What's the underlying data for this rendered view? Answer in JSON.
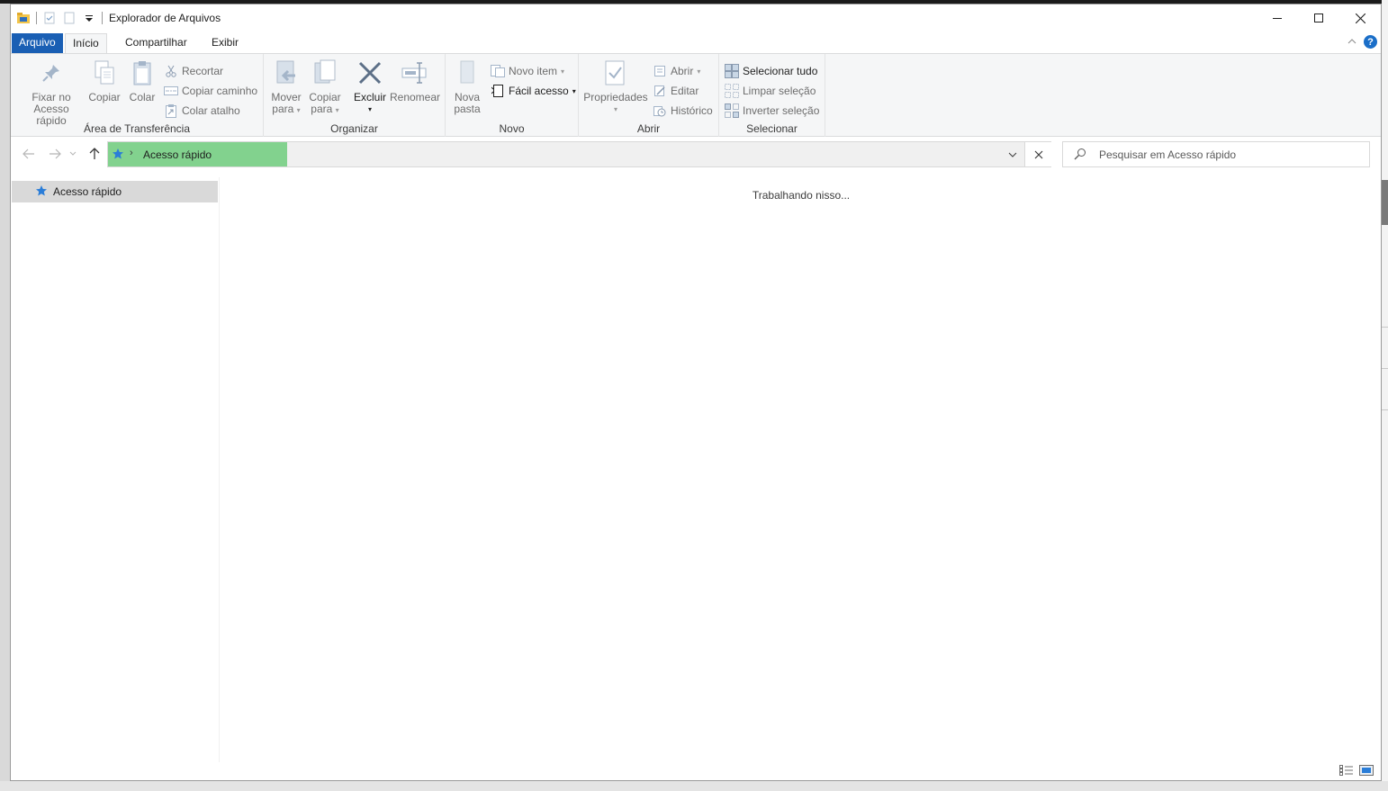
{
  "window": {
    "title": "Explorador de Arquivos"
  },
  "ribbon_tabs": {
    "file": "Arquivo",
    "home": "Início",
    "share": "Compartilhar",
    "view": "Exibir"
  },
  "help": "?",
  "clipboard": {
    "label": "Área de Transferência",
    "pin_line1": "Fixar no",
    "pin_line2": "Acesso rápido",
    "copy": "Copiar",
    "paste": "Colar",
    "cut": "Recortar",
    "copy_path": "Copiar caminho",
    "paste_shortcut": "Colar atalho"
  },
  "organize": {
    "label": "Organizar",
    "move_line1": "Mover",
    "move_line2": "para",
    "copyto_line1": "Copiar",
    "copyto_line2": "para",
    "delete": "Excluir",
    "rename": "Renomear"
  },
  "new": {
    "label": "Novo",
    "newfolder_line1": "Nova",
    "newfolder_line2": "pasta",
    "new_item": "Novo item",
    "easy_access": "Fácil acesso"
  },
  "open": {
    "label": "Abrir",
    "properties": "Propriedades",
    "open": "Abrir",
    "edit": "Editar",
    "history": "Histórico"
  },
  "select": {
    "label": "Selecionar",
    "select_all": "Selecionar tudo",
    "select_none": "Limpar seleção",
    "invert": "Inverter seleção"
  },
  "address": {
    "location": "Acesso rápido",
    "progress": 0.19
  },
  "search": {
    "placeholder": "Pesquisar em Acesso rápido"
  },
  "navpane": {
    "quick_access": "Acesso rápido"
  },
  "content": {
    "status": "Trabalhando nisso..."
  },
  "colors": {
    "file_tab": "#1a5fb4",
    "address_progress": "#82d28e",
    "selection": "#d9d9d9",
    "help": "#1a6ec8"
  }
}
